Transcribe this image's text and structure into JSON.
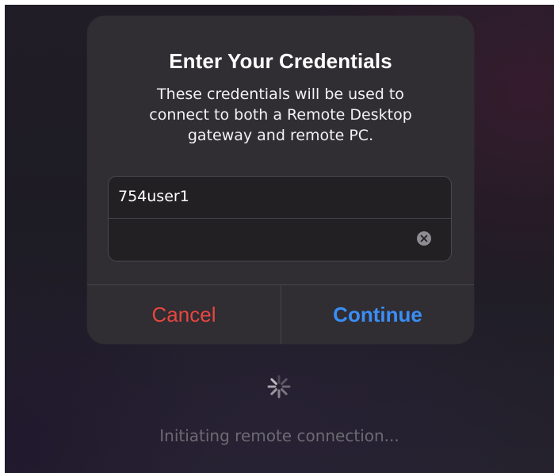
{
  "dialog": {
    "title": "Enter Your Credentials",
    "message": "These credentials will be used to\nconnect to both a Remote Desktop\ngateway and remote PC.",
    "username": {
      "value": "754user1"
    },
    "password": {
      "value": ""
    },
    "cancel_label": "Cancel",
    "continue_label": "Continue"
  },
  "status": {
    "text": "Initiating remote connection..."
  },
  "icons": {
    "clear": "clear-circle-icon",
    "spinner": "activity-spinner-icon"
  },
  "colors": {
    "cancel": "#e8473f",
    "continue": "#3a8ef6"
  }
}
